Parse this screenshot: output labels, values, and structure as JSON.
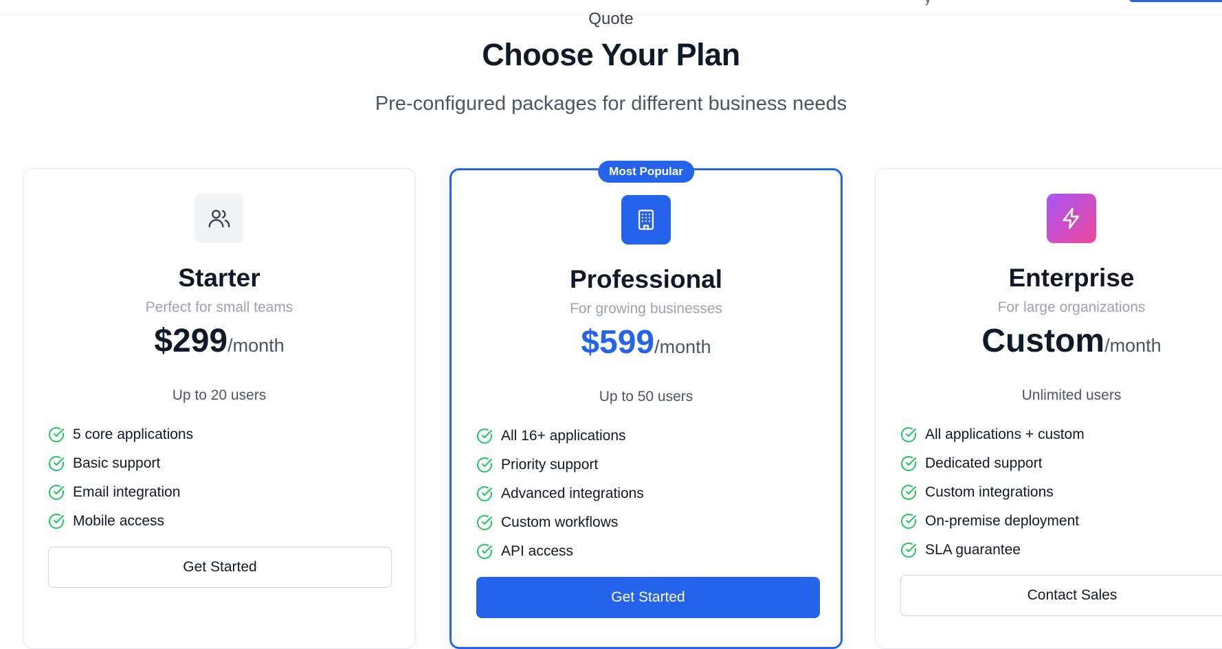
{
  "nav": {
    "partial_link_text": "y"
  },
  "header": {
    "eyebrow": "Quote",
    "title": "Choose Your Plan",
    "subtitle": "Pre-configured packages for different business needs"
  },
  "plans": [
    {
      "name": "Starter",
      "tagline": "Perfect for small teams",
      "price": "$299",
      "period": "/month",
      "users": "Up to 20 users",
      "icon": "users-icon",
      "features": [
        "5 core applications",
        "Basic support",
        "Email integration",
        "Mobile access"
      ],
      "cta": "Get Started"
    },
    {
      "badge": "Most Popular",
      "name": "Professional",
      "tagline": "For growing businesses",
      "price": "$599",
      "period": "/month",
      "users": "Up to 50 users",
      "icon": "building-icon",
      "features": [
        "All 16+ applications",
        "Priority support",
        "Advanced integrations",
        "Custom workflows",
        "API access"
      ],
      "cta": "Get Started"
    },
    {
      "name": "Enterprise",
      "tagline": "For large organizations",
      "price": "Custom",
      "period": "/month",
      "users": "Unlimited users",
      "icon": "lightning-icon",
      "features": [
        "All applications + custom",
        "Dedicated support",
        "Custom integrations",
        "On-premise deployment",
        "SLA guarantee"
      ],
      "cta": "Contact Sales"
    }
  ],
  "colors": {
    "primary": "#2563eb",
    "check": "#22c55e",
    "gradient_start": "#a855f7",
    "gradient_end": "#ec4899",
    "muted_text": "#9ca3af"
  }
}
